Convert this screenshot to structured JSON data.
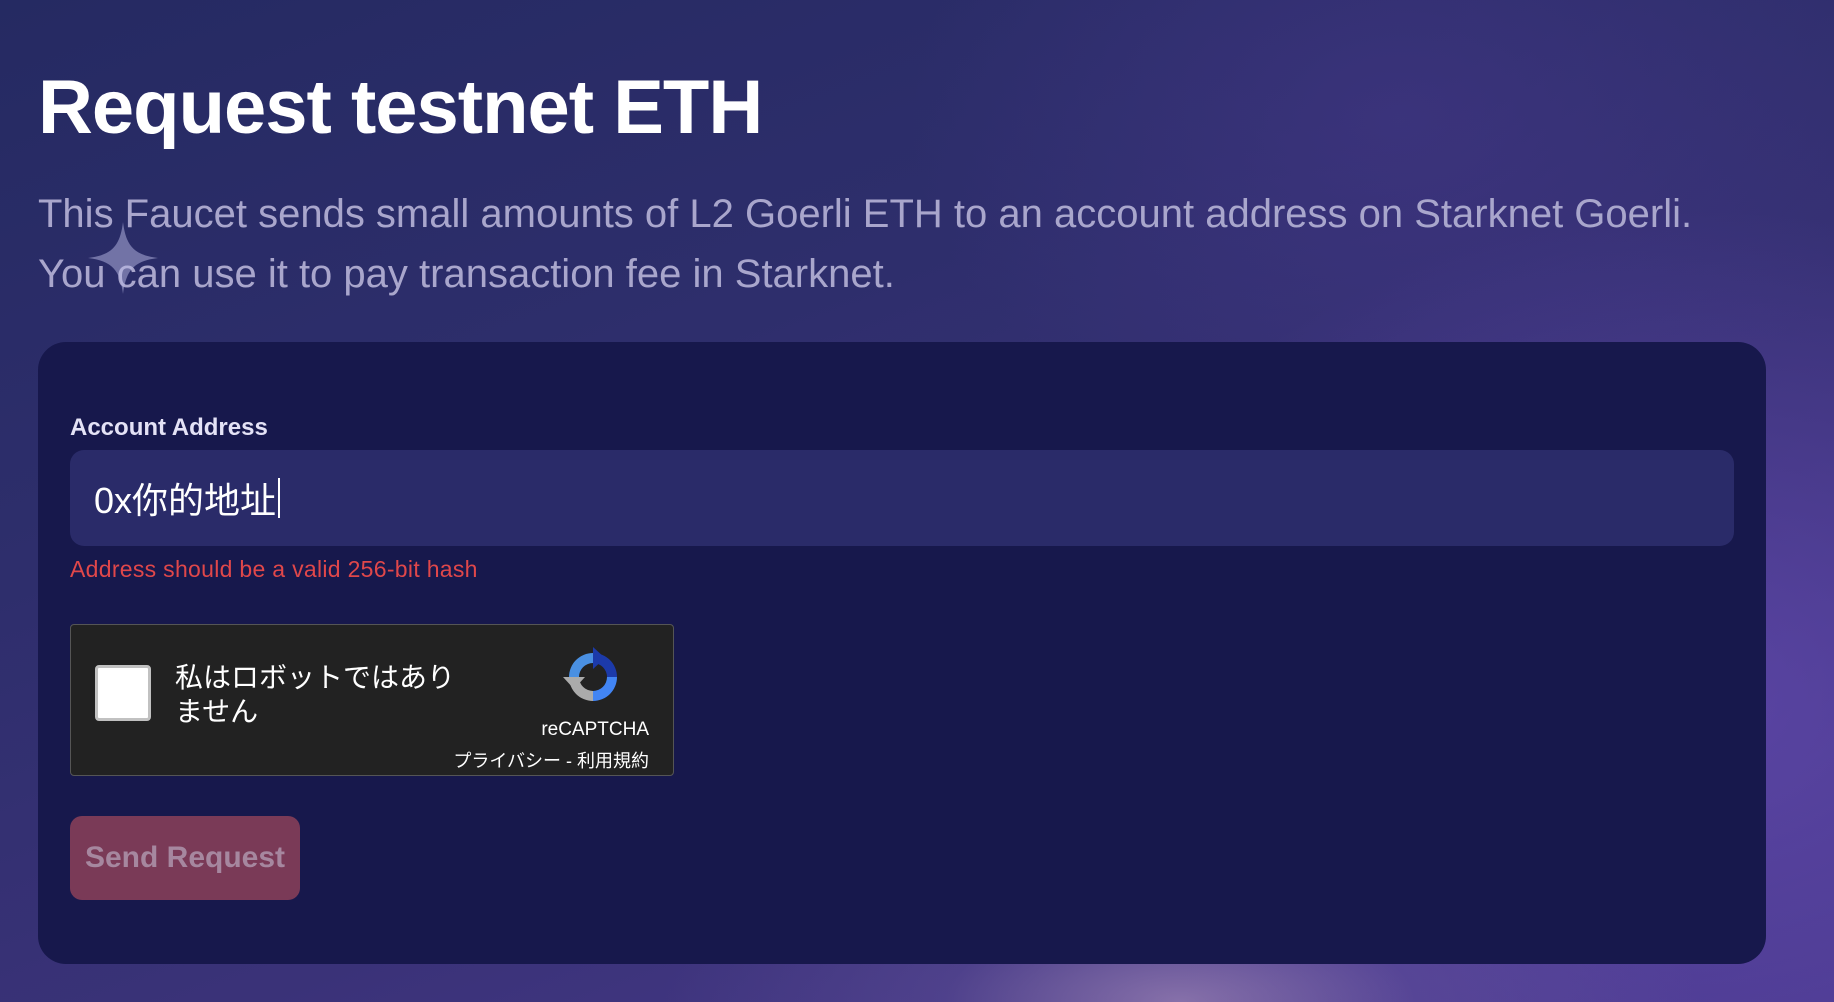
{
  "page": {
    "title": "Request testnet ETH",
    "intro": "This Faucet sends small amounts of L2 Goerli ETH to an account address on Starknet Goerli. You can use it to pay transaction fee in Starknet."
  },
  "form": {
    "address_label": "Account Address",
    "address_value": "0x你的地址",
    "error_message": "Address should be a valid 256-bit hash",
    "send_button_label": "Send Request",
    "send_button_state": "disabled"
  },
  "recaptcha": {
    "checkbox_label": "私はロボットではありません",
    "checked": false,
    "brand": "reCAPTCHA",
    "privacy_link": "プライバシー",
    "separator": " - ",
    "terms_link": "利用規約",
    "logo_icon": "recaptcha-logo-icon"
  },
  "colors": {
    "card_background": "#17184c",
    "input_background": "#2a2b69",
    "error": "#e0474a",
    "button_background": "#7a3a57",
    "button_text": "#a6879f",
    "intro_text": "#a9a6cc"
  }
}
